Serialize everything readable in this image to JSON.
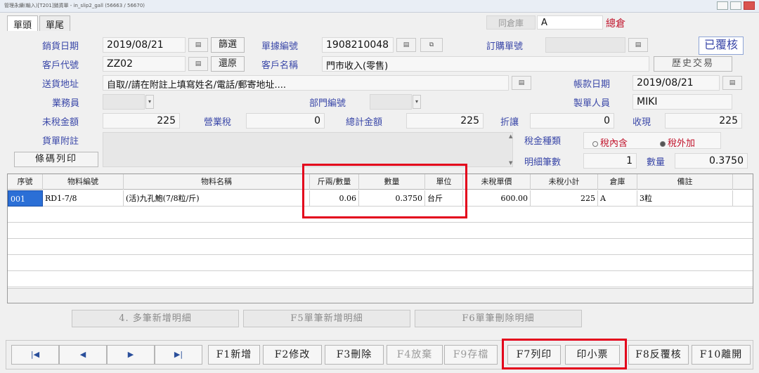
{
  "window": {
    "title": "管理永續(輸入)[T201]銷貨單 - in_slip2_gall  (56663 / 56670)"
  },
  "tabs": [
    {
      "label": "單頭"
    },
    {
      "label": "單尾"
    }
  ],
  "top": {
    "same_store_label": "同倉庫",
    "same_store_value": "A",
    "store_name": "總倉"
  },
  "form": {
    "sale_date_label": "銷貨日期",
    "sale_date": "2019/08/21",
    "filter_button": "篩選",
    "slip_no_label": "單據編號",
    "slip_no": "1908210048",
    "order_no_label": "訂購單號",
    "order_no": "",
    "status_stamp": "已覆核",
    "customer_code_label": "客戶代號",
    "customer_code": "ZZ02",
    "restore_button": "還原",
    "customer_name_label": "客戶名稱",
    "customer_name": "門市收入(零售)",
    "history_button": "歷史交易",
    "address_label": "送貨地址",
    "address": "自取//請在附註上填寫姓名/電話/郵寄地址....",
    "ledger_date_label": "帳款日期",
    "ledger_date": "2019/08/21",
    "salesperson_label": "業務員",
    "salesperson": "",
    "dept_label": "部門編號",
    "dept": "",
    "maker_label": "製單人員",
    "maker": "MIKI",
    "pretax_label": "未稅金額",
    "pretax": "225",
    "tax_label": "營業稅",
    "tax": "0",
    "total_label": "總計金額",
    "total": "225",
    "discount_label": "折讓",
    "discount": "0",
    "received_label": "收現",
    "received": "225",
    "note_label": "貨單附註",
    "note": "",
    "tax_type_label": "稅金種類",
    "tax_inclusive": "稅內含",
    "tax_exclusive": "稅外加",
    "detail_count_label": "明細筆數",
    "detail_count": "1",
    "qty_label": "數量",
    "qty": "0.3750",
    "barcode_button": "條碼列印"
  },
  "grid": {
    "headers": [
      "序號",
      "物料編號",
      "物料名稱",
      "斤兩/數量",
      "數量",
      "單位",
      "未稅單價",
      "未稅小計",
      "倉庫",
      "備註"
    ],
    "rows": [
      [
        "001",
        "RD1-7/8",
        "(活)九孔鮑(7/8粒/斤)",
        "0.06",
        "0.3750",
        "台斤",
        "600.00",
        "225",
        "A",
        "3粒"
      ]
    ]
  },
  "detail_buttons": [
    "4. 多筆新增明細",
    "F5單筆新增明細",
    "F6單筆刪除明細"
  ],
  "bottom_buttons": [
    "F1新增",
    "F2修改",
    "F3刪除",
    "F4放棄",
    "F9存檔",
    "F7列印",
    "印小票",
    "F8反覆核",
    "F10離開"
  ],
  "colors": {
    "highlight": "#e3001b",
    "label": "#3a47a8"
  }
}
